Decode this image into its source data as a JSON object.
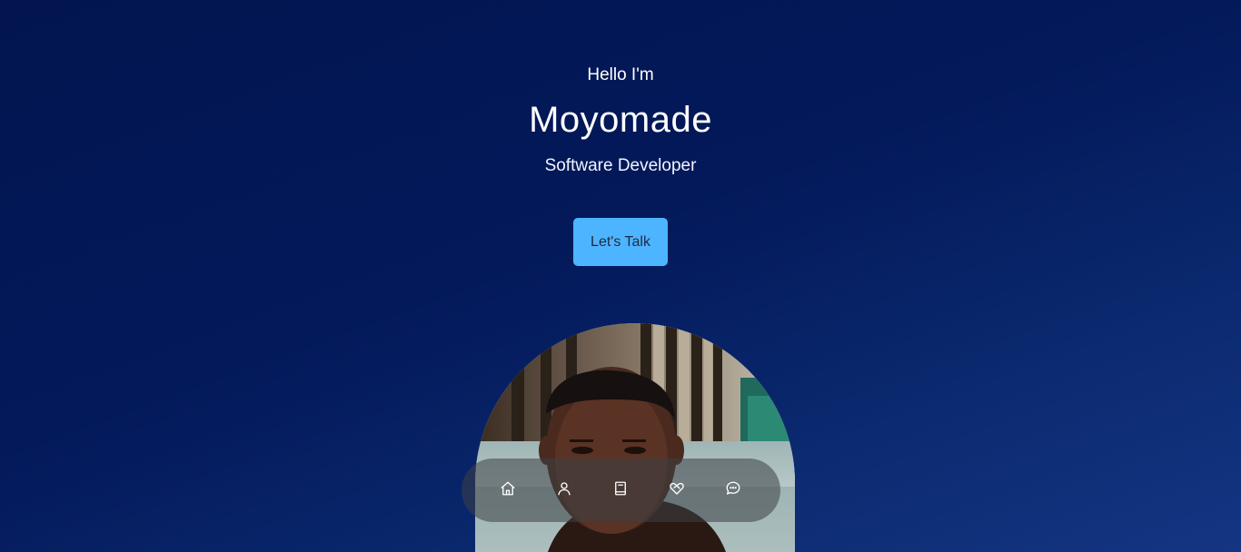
{
  "hero": {
    "greeting": "Hello I'm",
    "name": "Moyomade",
    "role": "Software Developer",
    "cta_label": "Let's Talk"
  },
  "photo": {
    "alt": "Portrait of Moyomade"
  },
  "nav": {
    "items": [
      {
        "icon": "home-icon"
      },
      {
        "icon": "user-icon"
      },
      {
        "icon": "book-icon"
      },
      {
        "icon": "handshake-icon"
      },
      {
        "icon": "chat-icon"
      }
    ]
  },
  "colors": {
    "background_top": "#021550",
    "background_bottom": "#143583",
    "accent": "#4db5ff",
    "text": "#ffffff"
  }
}
